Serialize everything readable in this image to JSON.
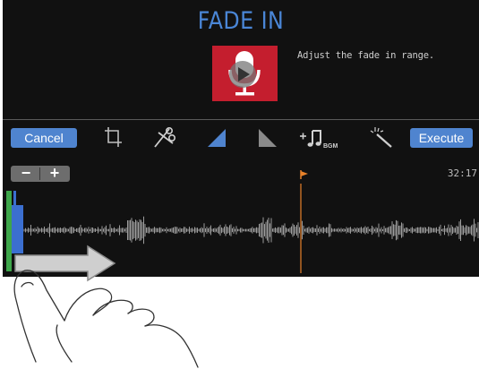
{
  "screen": {
    "title": "FADE IN",
    "instruction": "Adjust the fade in range.",
    "thumbnail_icon": "microphone-play-icon",
    "accent_color": "#4f84cf",
    "thumbnail_color": "#c41e2e",
    "marker_color": "#e8822a"
  },
  "toolbar": {
    "cancel_label": "Cancel",
    "execute_label": "Execute",
    "tools": [
      {
        "name": "trim-icon"
      },
      {
        "name": "scissors-icon"
      },
      {
        "name": "fade-in-icon"
      },
      {
        "name": "fade-out-icon"
      },
      {
        "name": "add-bgm-icon",
        "label": "BGM"
      },
      {
        "name": "magic-wand-icon"
      }
    ]
  },
  "timeline": {
    "zoom_out_label": "−",
    "zoom_in_label": "+",
    "time_readout": "32:17",
    "position_marker_icon": "flag-icon"
  },
  "gesture": {
    "hand_icon": "swipe-hand-icon",
    "arrow_icon": "swipe-right-arrow-icon"
  }
}
